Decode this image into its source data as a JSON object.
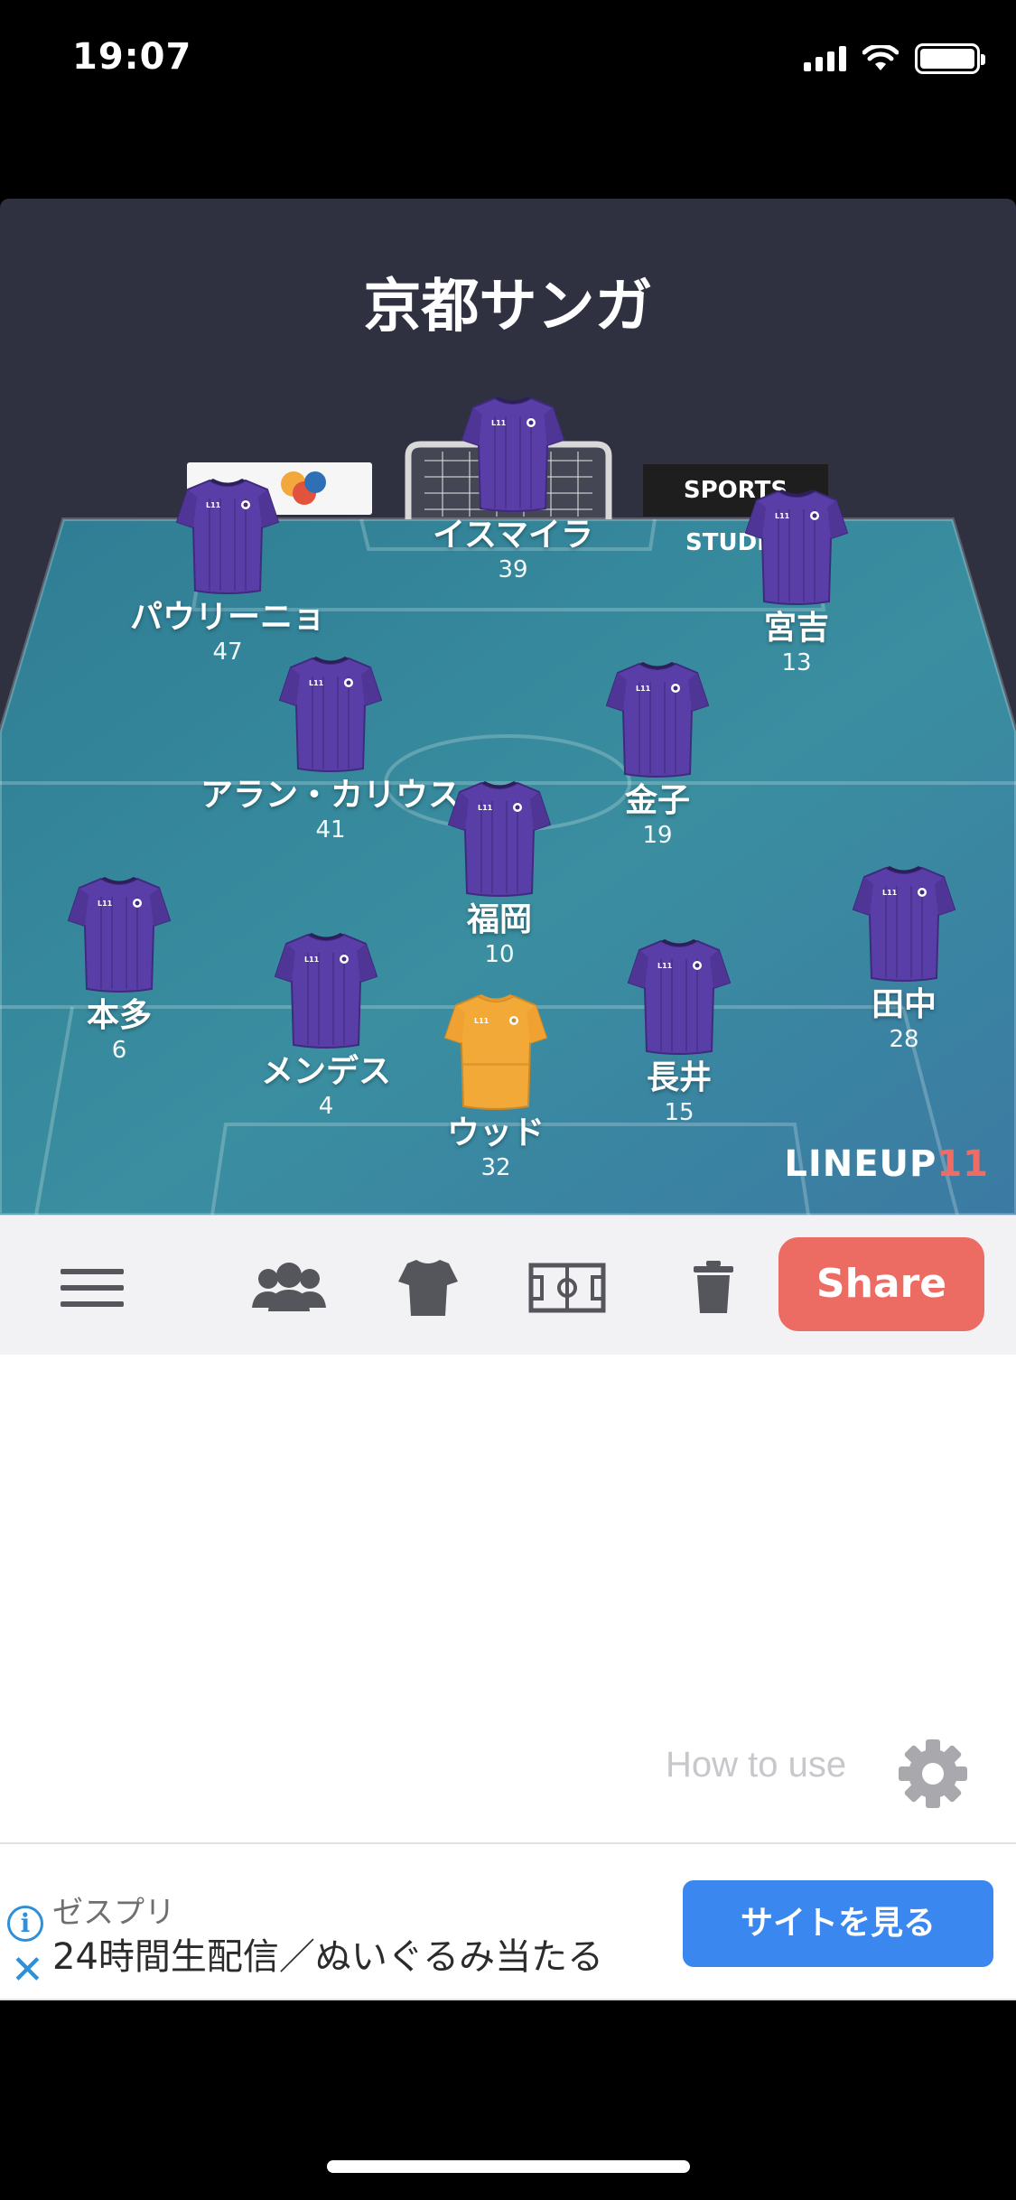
{
  "status": {
    "time": "19:07"
  },
  "team": {
    "name": "京都サンガ"
  },
  "boards": {
    "right": "SPORTS STUDIO"
  },
  "players": [
    {
      "name": "イスマイラ",
      "number": "39",
      "kit": "purple"
    },
    {
      "name": "パウリーニョ",
      "number": "47",
      "kit": "purple"
    },
    {
      "name": "宮吉",
      "number": "13",
      "kit": "purple"
    },
    {
      "name": "アラン・カリウス",
      "number": "41",
      "kit": "purple"
    },
    {
      "name": "金子",
      "number": "19",
      "kit": "purple"
    },
    {
      "name": "福岡",
      "number": "10",
      "kit": "purple"
    },
    {
      "name": "本多",
      "number": "6",
      "kit": "purple"
    },
    {
      "name": "田中",
      "number": "28",
      "kit": "purple"
    },
    {
      "name": "メンデス",
      "number": "4",
      "kit": "purple"
    },
    {
      "name": "長井",
      "number": "15",
      "kit": "purple"
    },
    {
      "name": "ウッド",
      "number": "32",
      "kit": "gold"
    }
  ],
  "brand": {
    "main": "LINEUP",
    "accent": "11"
  },
  "toolbar": {
    "menu_icon": "hamburger-icon",
    "players_icon": "group-icon",
    "kit_icon": "jersey-icon",
    "field_icon": "field-icon",
    "delete_icon": "trash-icon",
    "share_label": "Share"
  },
  "help": {
    "how_to_label": "How to use",
    "settings_icon": "gear-icon"
  },
  "ad": {
    "sponsor": "ゼスプリ",
    "text": "24時間生配信／ぬいぐるみ当たる",
    "cta": "サイトを見る"
  },
  "colors": {
    "share": "#ec6b63",
    "kit_purple": "#5a3ea8",
    "kit_gold": "#f3a938",
    "ad_cta": "#3b87f0",
    "pitch_dark": "#2f3140"
  }
}
